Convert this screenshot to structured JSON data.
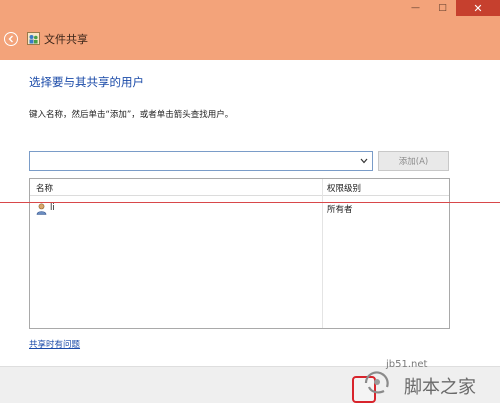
{
  "window": {
    "title": "文件共享",
    "minimize_glyph": "—",
    "maximize_glyph": "□",
    "close_glyph": "✕"
  },
  "dialog": {
    "heading": "选择要与其共享的用户",
    "instruction": "键入名称，然后单击“添加”，或者单击箭头查找用户。",
    "name_input": {
      "value": "",
      "placeholder": ""
    },
    "add_button_label": "添加(A)",
    "table": {
      "columns": [
        "名称",
        "权限级别"
      ],
      "rows": [
        {
          "name": "li",
          "permission": "所有者"
        }
      ]
    },
    "help_link": "共享时有问题"
  },
  "watermark": {
    "site": "jb51.net",
    "brand": "脚本之家"
  },
  "colors": {
    "titlebar": "#f3a37a",
    "accent_text": "#1a4aa8",
    "close_button": "#c6402e",
    "highlight_line": "#d8484a"
  },
  "icons": {
    "back": "back-arrow-icon",
    "app": "share-users-icon",
    "dropdown": "chevron-down-icon",
    "user": "user-icon"
  }
}
